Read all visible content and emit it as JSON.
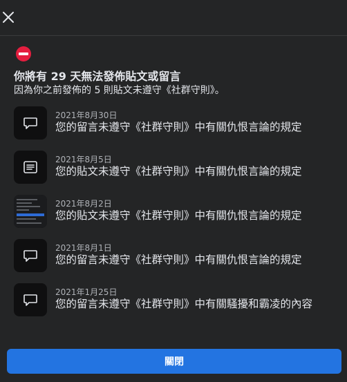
{
  "header": {
    "close_icon": "close-icon"
  },
  "notice": {
    "warning_icon": "no-entry-icon",
    "warning_color": "#e41e3f",
    "title": "你將有 29 天無法發佈貼文或留言",
    "subtitle": "因為你之前發佈的 5 則貼文未遵守《社群守則》。"
  },
  "violations": [
    {
      "icon": "comment-icon",
      "date": "2021年8月30日",
      "text": "您的留言未遵守《社群守則》中有關仇恨言論的規定"
    },
    {
      "icon": "post-icon",
      "date": "2021年8月5日",
      "text": "您的貼文未遵守《社群守則》中有關仇恨言論的規定"
    },
    {
      "icon": "screenshot-thumbnail",
      "date": "2021年8月2日",
      "text": "您的貼文未遵守《社群守則》中有關仇恨言論的規定"
    },
    {
      "icon": "comment-icon",
      "date": "2021年8月1日",
      "text": "您的留言未遵守《社群守則》中有關仇恨言論的規定"
    },
    {
      "icon": "comment-icon",
      "date": "2021年1月25日",
      "text": "您的留言未遵守《社群守則》中有關騷擾和霸凌的內容"
    }
  ],
  "footer": {
    "close_label": "關閉",
    "accent": "#2374e1"
  }
}
